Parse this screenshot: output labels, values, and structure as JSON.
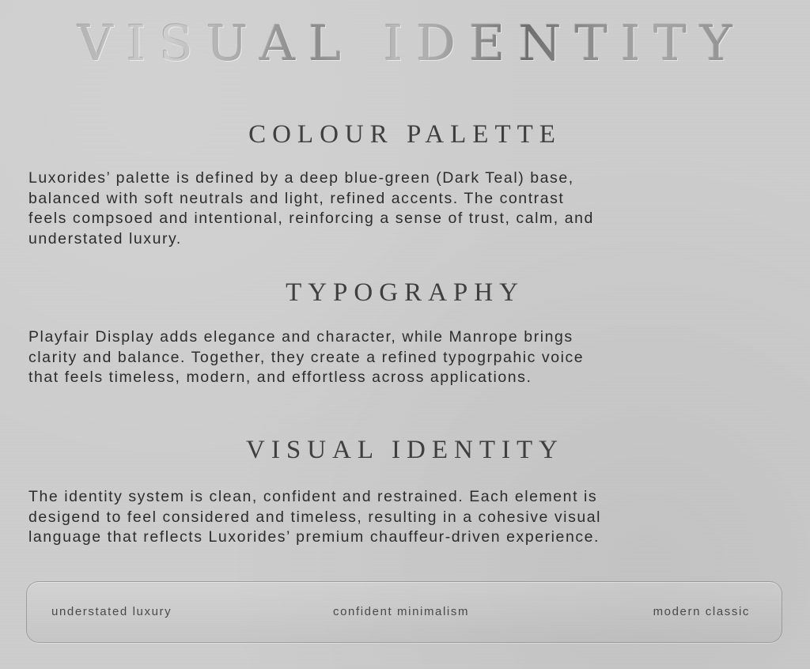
{
  "title": "VISUAL IDENTITY",
  "sections": [
    {
      "heading": "COLOUR PALETTE",
      "lines": [
        "Luxorides’ palette is defined by a deep blue-green (Dark Teal) base,",
        "balanced with soft neutrals and light, refined accents. The contrast",
        "feels compsoed and intentional, reinforcing a sense of trust, calm, and",
        "understated luxury."
      ]
    },
    {
      "heading": "TYPOGRAPHY",
      "lines": [
        "Playfair Display adds elegance and character, while Manrope brings",
        "clarity and balance. Together, they create a refined typogrpahic voice",
        "that feels timeless, modern, and effortless across applications."
      ]
    },
    {
      "heading": "VISUAL IDENTITY",
      "lines": [
        "The identity system is clean, confident and restrained. Each element is",
        "desigend to feel considered and timeless, resulting in a cohesive visual",
        "language that reflects Luxorides’ premium chauffeur-driven experience."
      ]
    }
  ],
  "keywords": [
    "understated luxury",
    "confident minimalism",
    "modern classic"
  ],
  "colors": {
    "background": "#cdcdcd",
    "heading": "#3f3f3f",
    "body": "#2c2c2c",
    "title_foil": "#8f8f8f"
  }
}
